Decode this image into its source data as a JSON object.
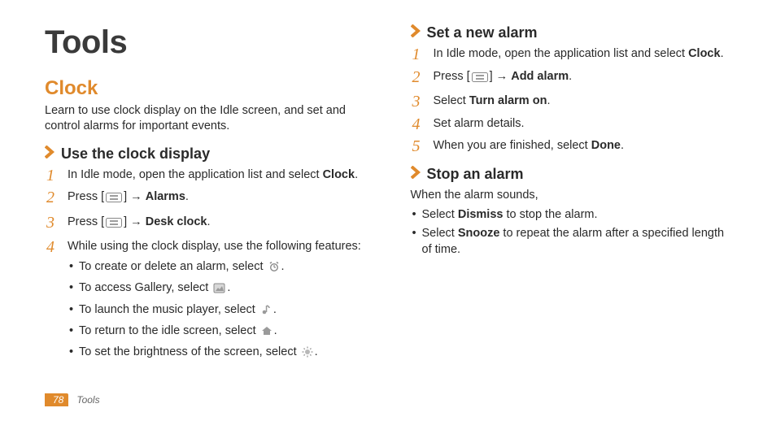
{
  "title": "Tools",
  "section": {
    "heading": "Clock",
    "intro": "Learn to use clock display on the Idle screen, and set and control alarms for important events."
  },
  "sub1": {
    "heading": "Use the clock display",
    "steps": {
      "s1a": "In Idle mode, open the application list and select ",
      "s1b": "Clock",
      "s1c": ".",
      "s2a": "Press [",
      "s2b": "] → ",
      "s2c": "Alarms",
      "s2d": ".",
      "s3a": "Press [",
      "s3b": "] → ",
      "s3c": "Desk clock",
      "s3d": ".",
      "s4": "While using the clock display, use the following features:"
    },
    "bullets": {
      "b1": "To create or delete an alarm, select ",
      "b2": "To access Gallery, select ",
      "b3": "To launch the music player, select ",
      "b4": "To return to the idle screen, select ",
      "b5": "To set the brightness of the screen, select "
    }
  },
  "sub2": {
    "heading": "Set a new alarm",
    "s1a": "In Idle mode, open the application list and select ",
    "s1b": "Clock",
    "s1c": ".",
    "s2a": "Press [",
    "s2b": "] → ",
    "s2c": "Add alarm",
    "s2d": ".",
    "s3a": "Select ",
    "s3b": "Turn alarm on",
    "s3c": ".",
    "s4": "Set alarm details.",
    "s5a": "When you are finished, select ",
    "s5b": "Done",
    "s5c": "."
  },
  "sub3": {
    "heading": "Stop an alarm",
    "intro": "When the alarm sounds,",
    "b1a": "Select ",
    "b1b": "Dismiss",
    "b1c": " to stop the alarm.",
    "b2a": "Select ",
    "b2b": "Snooze",
    "b2c": " to repeat the alarm after a specified length of time."
  },
  "footer": {
    "page": "78",
    "label": "Tools"
  }
}
